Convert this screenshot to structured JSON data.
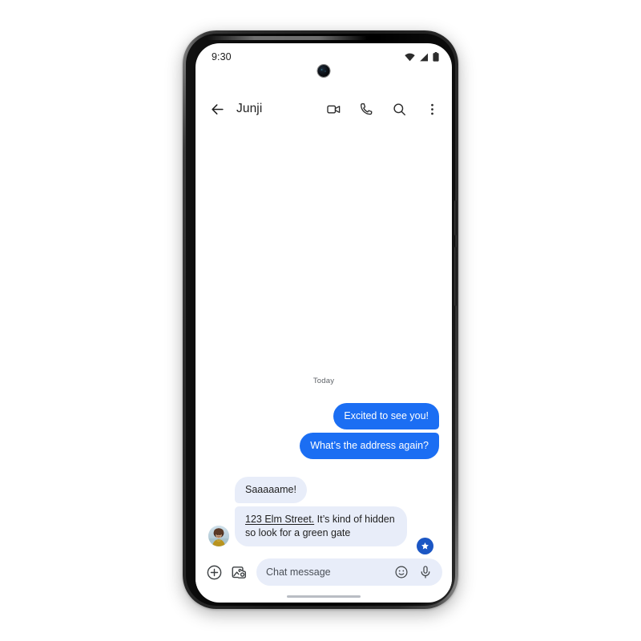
{
  "status_bar": {
    "time": "9:30",
    "icons": [
      "wifi-icon",
      "cellular-signal-icon",
      "battery-icon"
    ]
  },
  "app_bar": {
    "back_icon": "back-arrow-icon",
    "title": "Junji",
    "actions": [
      {
        "name": "video-call-icon",
        "label": "Video call"
      },
      {
        "name": "voice-call-icon",
        "label": "Call"
      },
      {
        "name": "search-icon",
        "label": "Search"
      },
      {
        "name": "more-options-icon",
        "label": "More options"
      }
    ]
  },
  "thread": {
    "day_divider": "Today",
    "messages": [
      {
        "id": "m1",
        "direction": "out",
        "text": "Excited to see you!",
        "group": "first"
      },
      {
        "id": "m2",
        "direction": "out",
        "text": "What’s the address again?",
        "group": "last"
      },
      {
        "id": "m3",
        "direction": "in",
        "text": "Saaaaame!",
        "group": "first"
      },
      {
        "id": "m4",
        "direction": "in",
        "link_text": "123 Elm Street.",
        "text": " It’s kind of hidden so look for a green gate",
        "group": "last",
        "has_avatar": true,
        "has_star_badge": true
      }
    ],
    "avatar": {
      "name": "contact-avatar",
      "alt": "Junji profile photo"
    },
    "star_badge": {
      "name": "star-badge-icon",
      "label": "Starred"
    }
  },
  "compose": {
    "add_icon": "add-attachment-icon",
    "gallery_icon": "gallery-camera-icon",
    "placeholder": "Chat message",
    "value": "",
    "emoji_icon": "emoji-icon",
    "mic_icon": "microphone-icon"
  },
  "colors": {
    "sent_bubble": "#1b6ef3",
    "received_bubble": "#e8edf9",
    "star_badge": "#1b56c4",
    "screen_bg": "#ffffff",
    "text_primary": "#1f1f1f",
    "text_secondary": "#5f6368"
  }
}
